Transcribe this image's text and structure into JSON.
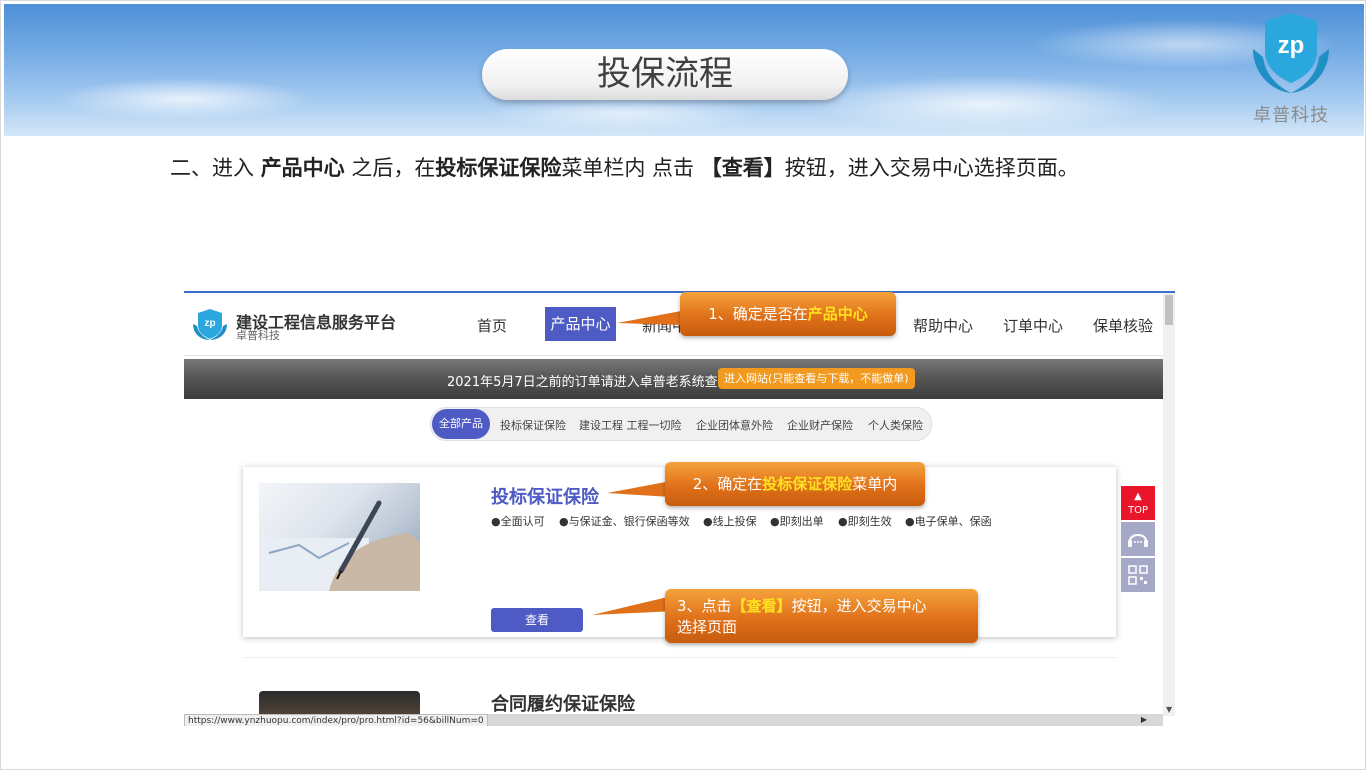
{
  "slide": {
    "title": "投保流程",
    "brand_name": "卓普科技",
    "instruction": {
      "p1": "二、进入 ",
      "b1": "产品中心",
      "p2": " 之后，在",
      "b2": "投标保证保险",
      "p3": "菜单栏内 点击 ",
      "b3": "【查看】",
      "p4": "按钮，进入交易中心选择页面。"
    }
  },
  "site": {
    "title": "建设工程信息服务平台",
    "subtitle": "卓普科技",
    "nav": [
      "首页",
      "产品中心",
      "新闻中心",
      "帮助中心",
      "订单中心",
      "保单核验"
    ],
    "banner_text": "2021年5月7日之前的订单请进入卓普老系统查看",
    "banner_button": "进入网站(只能查看与下载，不能做单)",
    "categories": [
      "全部产品",
      "投标保证保险",
      "建设工程 工程一切险",
      "企业团体意外险",
      "企业财产保险",
      "个人类保险"
    ],
    "product1": {
      "title": "投标保证保险",
      "features": [
        "●全面认可",
        "●与保证金、银行保函等效",
        "●线上投保",
        "●即刻出单",
        "●即刻生效",
        "●电子保单、保函"
      ],
      "view_button": "查看"
    },
    "product2": {
      "title": "合同履约保证保险"
    },
    "side_tools": {
      "top_label": "TOP"
    },
    "status_url": "https://www.ynzhuopu.com/index/pro/pro.html?id=56&billNum=0"
  },
  "callouts": {
    "c1": {
      "pre": "1、确定是否在",
      "hl": "产品中心",
      "post": ""
    },
    "c2": {
      "pre": "2、确定在",
      "hl": "投标保证保险",
      "post": "菜单内"
    },
    "c3": {
      "pre": "3、点击",
      "hl": "【查看】",
      "post": "按钮，进入交易中心",
      "line2": "选择页面"
    }
  },
  "colors": {
    "primary": "#4f5bc4",
    "callout": "#e0711a",
    "highlight": "#ffe21f",
    "top_button": "#e9152a"
  }
}
